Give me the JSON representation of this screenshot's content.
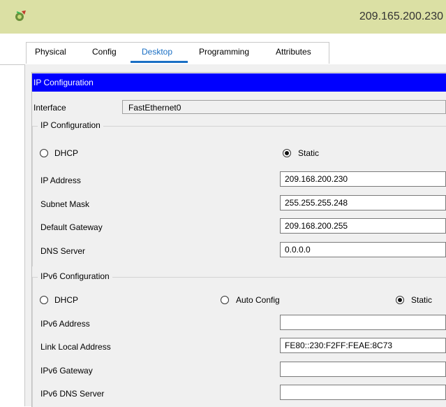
{
  "window": {
    "title": "209.165.200.230",
    "app_icon": "packet-tracer-icon"
  },
  "tabs": [
    {
      "label": "Physical",
      "active": false
    },
    {
      "label": "Config",
      "active": false
    },
    {
      "label": "Desktop",
      "active": true
    },
    {
      "label": "Programming",
      "active": false
    },
    {
      "label": "Attributes",
      "active": false
    }
  ],
  "panel": {
    "header": "IP Configuration"
  },
  "interface": {
    "label": "Interface",
    "value": "FastEthernet0"
  },
  "ipv4": {
    "group_title": "IP Configuration",
    "dhcp_label": "DHCP",
    "static_label": "Static",
    "selected": "Static",
    "ip_address_label": "IP Address",
    "ip_address": "209.168.200.230",
    "subnet_mask_label": "Subnet Mask",
    "subnet_mask": "255.255.255.248",
    "gateway_label": "Default Gateway",
    "gateway": "209.168.200.255",
    "dns_label": "DNS Server",
    "dns": "0.0.0.0"
  },
  "ipv6": {
    "group_title": "IPv6 Configuration",
    "dhcp_label": "DHCP",
    "auto_label": "Auto Config",
    "static_label": "Static",
    "selected": "Static",
    "address_label": "IPv6 Address",
    "address": "",
    "link_local_label": "Link Local Address",
    "link_local": "FE80::230:F2FF:FEAE:8C73",
    "gateway_label": "IPv6 Gateway",
    "gateway": "",
    "dns_label": "IPv6 DNS Server",
    "dns": ""
  },
  "colors": {
    "titlebar": "#dbe0a4",
    "header": "#0000ff",
    "active_tab": "#1a6fc4",
    "panel_bg": "#f0f0f0"
  }
}
